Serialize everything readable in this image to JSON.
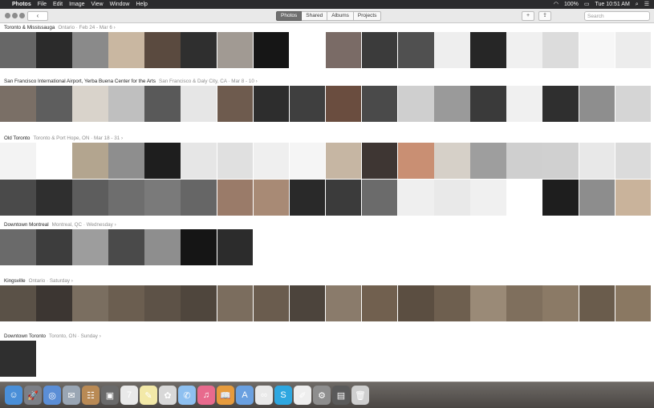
{
  "menubar": {
    "app": "Photos",
    "items": [
      "File",
      "Edit",
      "Image",
      "View",
      "Window",
      "Help"
    ],
    "battery": "100%",
    "clock": "Tue 10:51 AM"
  },
  "toolbar": {
    "tabs": [
      "Photos",
      "Shared",
      "Albums",
      "Projects"
    ],
    "active_tab": "Photos",
    "search_placeholder": "Search"
  },
  "moments": [
    {
      "title": "Toronto & Mississauga",
      "subtitle": "Ontario · Feb 24 - Mar 6 ›",
      "rows": [
        [
          "#676767",
          "#2b2b2b",
          "#8a8a8a",
          "#c9b7a1",
          "#5a4a3f",
          "#2f2f2f",
          "#a19a93",
          "#161616",
          "#ffffff",
          "#7a6b66",
          "#3b3b3b",
          "#505050",
          "#eeeeee",
          "#262626",
          "#f0f0f0",
          "#dcdcdc",
          "#f7f7f7",
          "#ececec"
        ]
      ]
    },
    {
      "title": "San Francisco International Airport, Yerba Buena Center for the Arts",
      "subtitle": "San Francisco & Daly City, CA · Mar 8 - 10 ›",
      "rows": [
        [
          "#7a6f66",
          "#5e5e5e",
          "#d9d3cb",
          "#bfbfbf",
          "#595959",
          "#e6e6e6",
          "#6e5b4e",
          "#2d2d2d",
          "#3f3f3f",
          "#6a4d3f",
          "#4a4a4a",
          "#cfcfcf",
          "#9a9a9a",
          "#3a3a3a",
          "#f0f0f0",
          "#2f2f2f",
          "#8e8e8e",
          "#d5d5d5"
        ]
      ]
    },
    {
      "title": "Old Toronto",
      "subtitle": "Toronto & Port Hope, ON · Mar 18 - 31 ›",
      "rows": [
        [
          "#f3f3f3",
          "#ffffff",
          "#b3a58f",
          "#8e8e8e",
          "#1e1e1e",
          "#e6e6e6",
          "#e0e0e0",
          "#efefef",
          "#f5f5f5",
          "#c6b6a3",
          "#3e3633",
          "#c98f73",
          "#d6d0c8",
          "#9e9e9e",
          "#cfcfcf",
          "#d0d0d0",
          "#e8e8e8",
          "#dbdbdb"
        ],
        [
          "#4a4a4a",
          "#2f2f2f",
          "#5d5d5d",
          "#6e6e6e",
          "#7a7a7a",
          "#666666",
          "#9a7b69",
          "#a88a75",
          "#292929",
          "#3b3b3b",
          "#6b6b6b",
          "#efefef",
          "#e9e9e9",
          "#f0f0f0",
          "#ffffff",
          "#1e1e1e",
          "#8d8d8d",
          "#c9b39b"
        ]
      ]
    },
    {
      "title": "Downtown Montreal",
      "subtitle": "Montreal, QC · Wednesday ›",
      "rows": [
        [
          "#6a6a6a",
          "#3d3d3d",
          "#9d9d9d",
          "#4a4a4a",
          "#8e8e8e",
          "#151515",
          "#2c2c2c"
        ]
      ]
    },
    {
      "title": "Kingsville",
      "subtitle": "Ontario · Saturday ›",
      "rows": [
        [
          "#5a5147",
          "#3c3632",
          "#7a6e60",
          "#6b5e50",
          "#5d5247",
          "#4f463d",
          "#7b6d5e",
          "#6a5c4e",
          "#4c443c",
          "#8a7b6b",
          "#71604f",
          "#5b4e41",
          "#6e5f4f",
          "#9a8a77",
          "#7f6f5d",
          "#8b7a66",
          "#6a5c4c",
          "#8a7862"
        ]
      ]
    },
    {
      "title": "Downtown Toronto",
      "subtitle": "Toronto, ON · Sunday ›",
      "rows": [
        [
          "#2f2f2f"
        ]
      ]
    }
  ],
  "dock": {
    "icons": [
      {
        "name": "finder",
        "color": "#4a8fd8",
        "glyph": "☺"
      },
      {
        "name": "launchpad",
        "color": "#7c7f86",
        "glyph": "🚀"
      },
      {
        "name": "safari",
        "color": "#5b8ed6",
        "glyph": "◎"
      },
      {
        "name": "mail",
        "color": "#9aa6b4",
        "glyph": "✉"
      },
      {
        "name": "contacts",
        "color": "#b98a55",
        "glyph": "☷"
      },
      {
        "name": "photo-app",
        "color": "#6a6a6a",
        "glyph": "▣"
      },
      {
        "name": "calendar",
        "color": "#e9e9e9",
        "glyph": "7"
      },
      {
        "name": "notes",
        "color": "#f3e9a8",
        "glyph": "✎"
      },
      {
        "name": "photos",
        "color": "#d8d8d8",
        "glyph": "✿"
      },
      {
        "name": "messages",
        "color": "#8ec0f0",
        "glyph": "✆"
      },
      {
        "name": "music",
        "color": "#e86a8d",
        "glyph": "♫"
      },
      {
        "name": "books",
        "color": "#e69b3d",
        "glyph": "📖"
      },
      {
        "name": "app-store",
        "color": "#6aa0e0",
        "glyph": "A"
      },
      {
        "name": "creative-cloud",
        "color": "#e9e9e9",
        "glyph": "∞"
      },
      {
        "name": "skype",
        "color": "#2ea7e0",
        "glyph": "S"
      },
      {
        "name": "notes-2",
        "color": "#eeeeee",
        "glyph": "✐"
      },
      {
        "name": "system-preferences",
        "color": "#8e8e8e",
        "glyph": "⚙"
      },
      {
        "name": "folder",
        "color": "#5a5a5a",
        "glyph": "▤"
      },
      {
        "name": "trash",
        "color": "#cfcfcf",
        "glyph": "🗑"
      }
    ]
  }
}
